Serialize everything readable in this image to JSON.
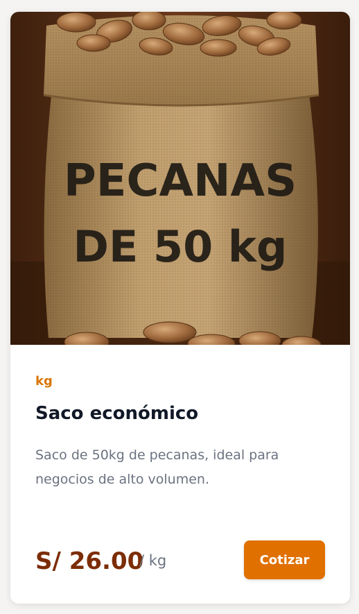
{
  "product": {
    "image": {
      "sack_text_line1": "PECANAS",
      "sack_text_line2": "DE 50 kg"
    },
    "unit_tag": "kg",
    "title": "Saco económico",
    "description": "Saco de 50kg de pecanas, ideal para negocios de alto volumen.",
    "price": "S/ 26.00",
    "price_unit": "/ kg",
    "cta_label": "Cotizar"
  },
  "colors": {
    "accent": "#e07000",
    "price": "#7c2d07",
    "tag": "#d9770a"
  }
}
